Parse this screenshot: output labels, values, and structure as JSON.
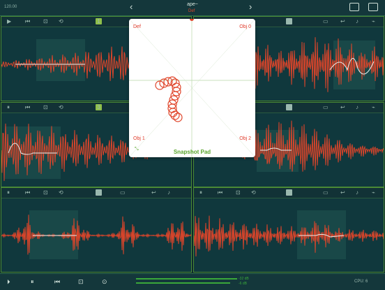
{
  "app": {
    "title": "ape~",
    "bpm": "120.00"
  },
  "panes": [
    {
      "id": "pane-1",
      "num": "1",
      "numColor": "#8fbf4a"
    },
    {
      "id": "pane-2",
      "num": "2",
      "numColor": "#9ab8ae"
    },
    {
      "id": "pane-3",
      "num": "3",
      "numColor": "#8fbf4a"
    },
    {
      "id": "pane-4",
      "num": "4",
      "numColor": "#9ab8ae"
    },
    {
      "id": "pane-5",
      "num": "5",
      "numColor": "#9ab8ae"
    },
    {
      "id": "pane-6",
      "num": "6",
      "numColor": "#9ab8ae"
    }
  ],
  "snapshot": {
    "title": "Snapshot Pad",
    "top_marker": "Def",
    "corners": {
      "tl": "Def",
      "tr": "Obj 0",
      "bl": "Obj 1",
      "br": "Obj 2"
    }
  },
  "bottom": {
    "cpu": "CPU: 6",
    "db_top": "-32 dB",
    "db_bottom": "-6 dB"
  },
  "colors": {
    "wave": "#e0452a",
    "grid": "#2a5f57",
    "accent": "#5aa52e"
  }
}
